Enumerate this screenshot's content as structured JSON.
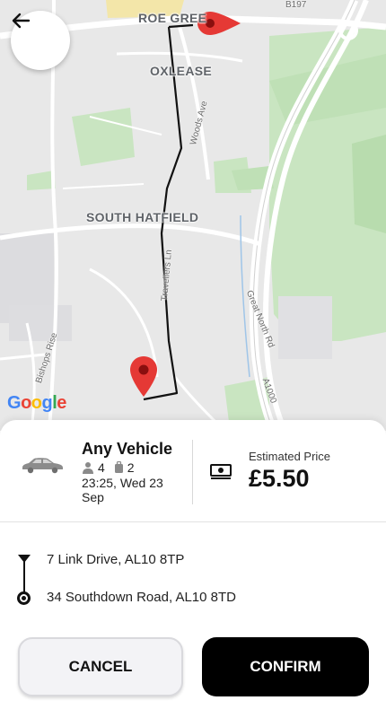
{
  "map": {
    "labels": {
      "roe_green": "ROE GREE",
      "oxlease": "OXLEASE",
      "south_hatfield": "SOUTH HATFIELD"
    },
    "roads": {
      "woods_ave": "Woods Ave",
      "travellers_ln": "Travellers Ln",
      "bishops_rise": "Bishops Rise",
      "great_north_rd": "Great North Rd",
      "a1000": "A1000",
      "b197": "B197"
    },
    "attribution": "Google",
    "pickup_pin_color": "#d93025",
    "route_color": "#111111"
  },
  "back_button": {
    "icon": "arrow-left-icon"
  },
  "ride": {
    "vehicle_icon": "car-icon",
    "vehicle_name": "Any Vehicle",
    "passengers_icon": "person-icon",
    "passengers": "4",
    "luggage_icon": "luggage-icon",
    "luggage": "2",
    "datetime": "23:25, Wed 23 Sep",
    "price_icon": "money-icon",
    "price_label": "Estimated Price",
    "price": "£5.50"
  },
  "route": {
    "pickup": "7 Link Drive, AL10 8TP",
    "dropoff": "34 Southdown Road, AL10 8TD"
  },
  "actions": {
    "cancel": "CANCEL",
    "confirm": "CONFIRM"
  },
  "colors": {
    "confirm_bg": "#000000",
    "cancel_bg": "#f3f3f6"
  }
}
